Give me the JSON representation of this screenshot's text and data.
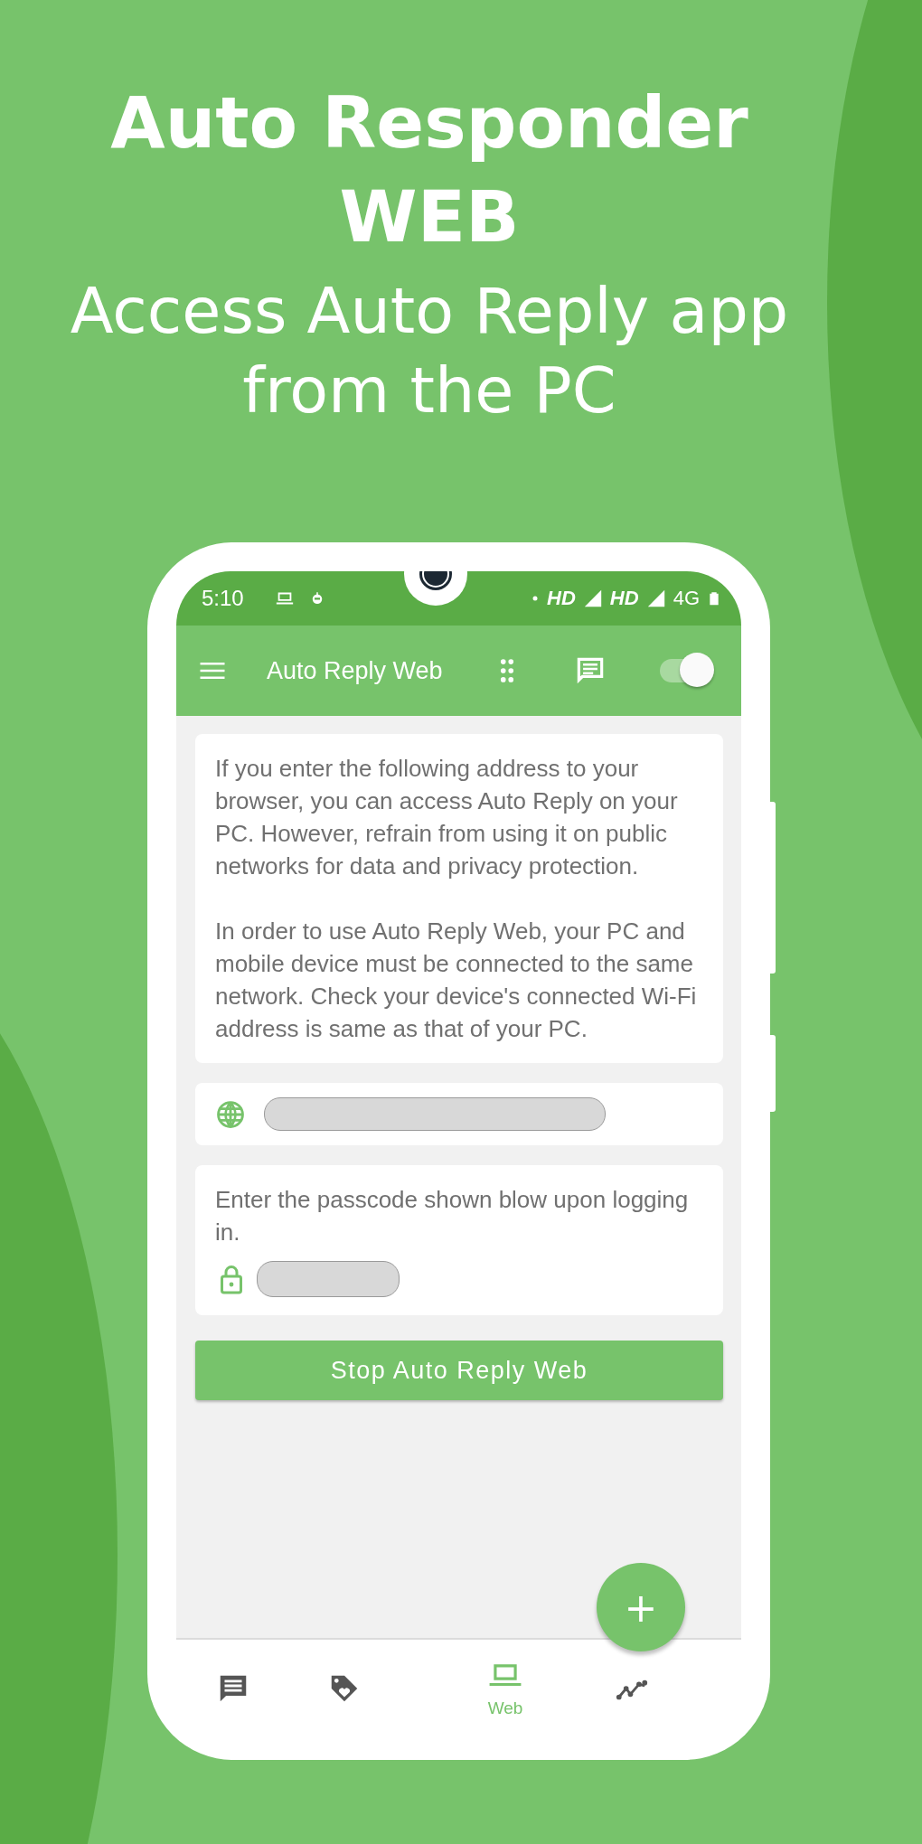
{
  "headline": {
    "title_lines": [
      "Auto Responder",
      "WEB"
    ],
    "subtitle_lines": [
      "Access Auto Reply app",
      "from the PC"
    ]
  },
  "status_bar": {
    "time": "5:10",
    "network_labels": [
      "HD",
      "HD",
      "4G"
    ]
  },
  "toolbar": {
    "title": "Auto Reply Web",
    "toggle_on": true
  },
  "info_card": {
    "paragraphs": [
      "If you enter the following address to your browser, you can access Auto Reply on your PC. However, refrain from using it on public networks for data and privacy protection.",
      "In order to use Auto Reply Web, your PC and mobile device must be connected to the same network. Check your device's connected Wi-Fi address is same as that of your PC."
    ]
  },
  "passcode_card": {
    "label": "Enter the passcode shown blow upon logging in."
  },
  "stop_button": {
    "label": "Stop Auto Reply Web"
  },
  "fab": {
    "label": "+"
  },
  "bottom_nav": [
    {
      "kind": "messages",
      "selected": false
    },
    {
      "kind": "tags",
      "selected": false
    },
    {
      "kind": "web",
      "label": "Web",
      "selected": true
    },
    {
      "kind": "stats",
      "selected": false
    }
  ]
}
